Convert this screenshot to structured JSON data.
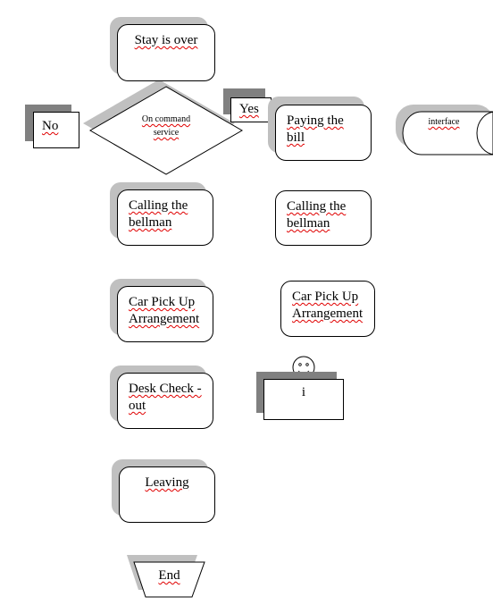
{
  "nodes": {
    "stay_over": "Stay is over",
    "decision": "On command service",
    "no": "No",
    "yes": "Yes",
    "paying_bill": "Paying the bill",
    "interface": "interface",
    "calling_bellman_left": "Calling the bellman",
    "calling_bellman_right": "Calling the bellman",
    "car_pickup_left": "Car Pick Up Arrangement",
    "car_pickup_right": "Car Pick Up Arrangement",
    "desk_checkout": "Desk Check -out",
    "actor": "i",
    "leaving": "Leaving",
    "end": "End"
  },
  "colors": {
    "shadow_light": "#c0c0c0",
    "shadow_dark": "#808080",
    "spellcheck": "#e00000"
  }
}
